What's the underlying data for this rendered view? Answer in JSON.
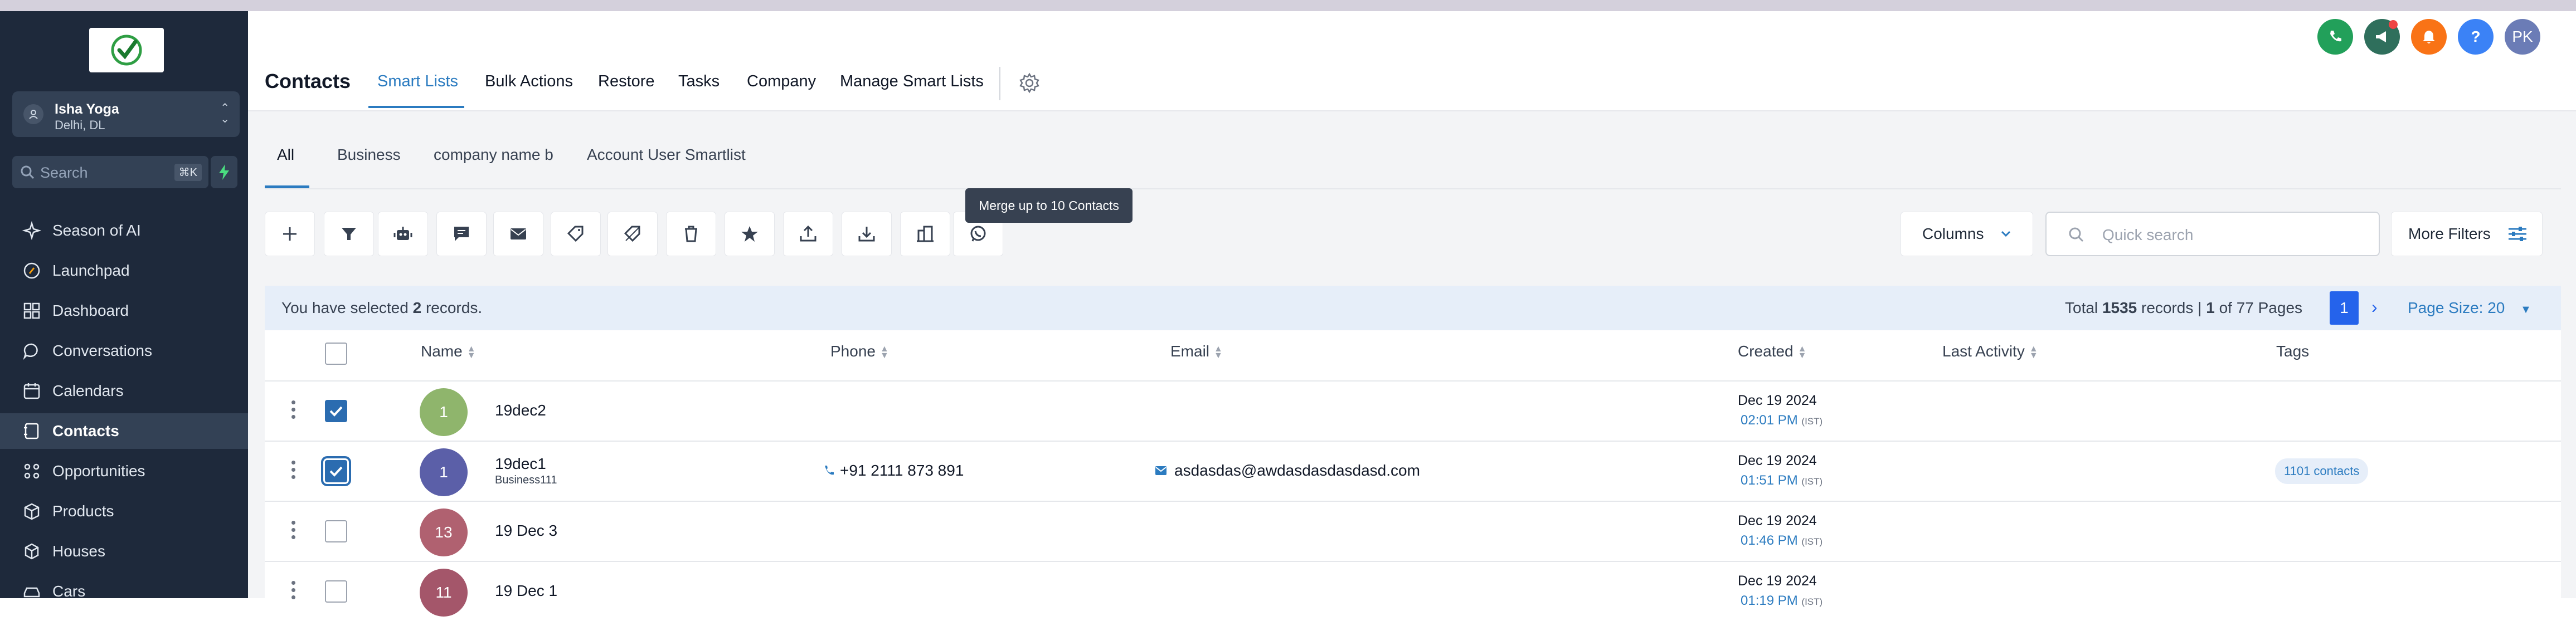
{
  "sidebar": {
    "location": {
      "name": "Isha Yoga",
      "city": "Delhi, DL"
    },
    "search": {
      "placeholder": "Search",
      "shortcut": "⌘K"
    },
    "items": [
      {
        "label": "Season of AI",
        "icon": "sparkle-icon"
      },
      {
        "label": "Launchpad",
        "icon": "rocket-icon"
      },
      {
        "label": "Dashboard",
        "icon": "grid-icon"
      },
      {
        "label": "Conversations",
        "icon": "chat-icon"
      },
      {
        "label": "Calendars",
        "icon": "calendar-icon"
      },
      {
        "label": "Contacts",
        "icon": "contacts-icon",
        "active": true
      },
      {
        "label": "Opportunities",
        "icon": "funnel-icon"
      },
      {
        "label": "Products",
        "icon": "box-icon"
      },
      {
        "label": "Houses",
        "icon": "cube-icon"
      },
      {
        "label": "Cars",
        "icon": "car-icon"
      }
    ]
  },
  "header": {
    "title": "Contacts",
    "tabs": [
      {
        "label": "Smart Lists",
        "active": true
      },
      {
        "label": "Bulk Actions"
      },
      {
        "label": "Restore"
      },
      {
        "label": "Tasks"
      },
      {
        "label": "Company"
      },
      {
        "label": "Manage Smart Lists"
      }
    ],
    "avatar_initials": "PK"
  },
  "subtabs": [
    {
      "label": "All",
      "active": true
    },
    {
      "label": "Business"
    },
    {
      "label": "company name b"
    },
    {
      "label": "Account User Smartlist"
    }
  ],
  "toolbar": {
    "tooltip": "Merge up to 10 Contacts",
    "columns_label": "Columns",
    "quick_search_placeholder": "Quick search",
    "more_filters_label": "More Filters"
  },
  "selection": {
    "prefix": "You have selected ",
    "count": "2",
    "suffix": " records.",
    "total_prefix": "Total ",
    "total": "1535",
    "total_mid": " records | ",
    "page": "1",
    "page_suffix": " of 77 Pages",
    "current_page": "1",
    "page_size": "Page Size: 20"
  },
  "table": {
    "headers": [
      "Name",
      "Phone",
      "Email",
      "Created",
      "Last Activity",
      "Tags"
    ],
    "rows": [
      {
        "avatar": "1",
        "avatar_color": "#8fb56c",
        "name": "19dec2",
        "business": "",
        "phone": "",
        "email": "",
        "date": "Dec 19 2024",
        "time": "02:01 PM",
        "tz": "(IST)",
        "tag": "",
        "checked": true
      },
      {
        "avatar": "1",
        "avatar_color": "#5b5fa8",
        "name": "19dec1",
        "business": "Business111",
        "phone": "+91 2111 873 891",
        "email": "asdasdas@awdasdasdasdasd.com",
        "date": "Dec 19 2024",
        "time": "01:51 PM",
        "tz": "(IST)",
        "tag": "1101 contacts",
        "checked": true
      },
      {
        "avatar": "13",
        "avatar_color": "#b06170",
        "name": "19 Dec 3",
        "business": "",
        "phone": "",
        "email": "",
        "date": "Dec 19 2024",
        "time": "01:46 PM",
        "tz": "(IST)",
        "tag": "",
        "checked": false
      },
      {
        "avatar": "11",
        "avatar_color": "#a4566a",
        "name": "19 Dec 1",
        "business": "",
        "phone": "",
        "email": "",
        "date": "Dec 19 2024",
        "time": "01:19 PM",
        "tz": "(IST)",
        "tag": "",
        "checked": false
      }
    ]
  },
  "colors": {
    "accent": "#2b7bc0",
    "sidebar": "#1e293b",
    "primary": "#2563eb"
  }
}
